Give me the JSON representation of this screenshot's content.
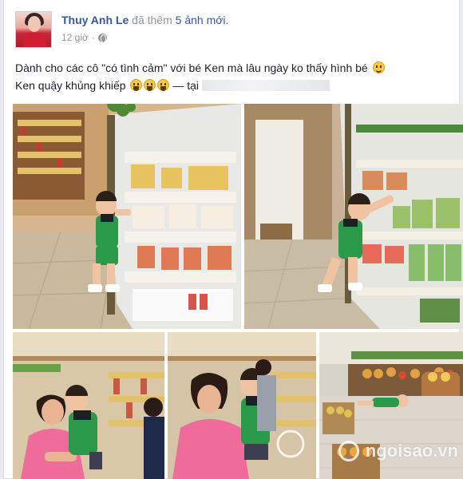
{
  "post": {
    "author": "Thuy Anh Le",
    "action": "đã thêm",
    "photo_count": "5 ảnh mới.",
    "time": "12 giờ",
    "separator": "·",
    "privacy_icon": "globe-icon",
    "text_main": "Dành cho các cô \"có tình cảm\" với bé Ken mà lâu ngày ko thấy hình bé",
    "text_second": "Ken quậy khủng khiếp",
    "text_dash": "— tại",
    "emoji_icons": [
      "smile-emoji-icon",
      "laugh-emoji-icon",
      "laugh-emoji-icon",
      "laugh-emoji-icon"
    ]
  },
  "watermark": {
    "text": "ngoisao.vn"
  },
  "colors": {
    "link": "#365899",
    "muted": "#90949c",
    "text": "#1d2129",
    "background": "#e9ebee"
  }
}
